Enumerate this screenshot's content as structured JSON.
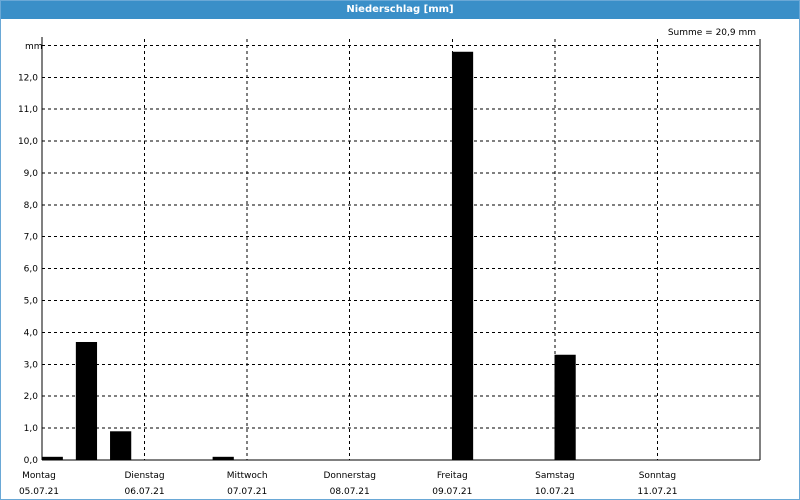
{
  "window": {
    "title": "Niederschlag [mm]"
  },
  "chart_data": {
    "type": "bar",
    "title": "Niederschlag [mm]",
    "summary_label": "Summe = 20,9 mm",
    "ylabel": "mm",
    "ylim": [
      0,
      13.2
    ],
    "yticks": [
      {
        "value": 0.0,
        "label": "0,0"
      },
      {
        "value": 1.0,
        "label": "1,0"
      },
      {
        "value": 2.0,
        "label": "2,0"
      },
      {
        "value": 3.0,
        "label": "3,0"
      },
      {
        "value": 4.0,
        "label": "4,0"
      },
      {
        "value": 5.0,
        "label": "5,0"
      },
      {
        "value": 6.0,
        "label": "6,0"
      },
      {
        "value": 7.0,
        "label": "7,0"
      },
      {
        "value": 8.0,
        "label": "8,0"
      },
      {
        "value": 9.0,
        "label": "9,0"
      },
      {
        "value": 10.0,
        "label": "10,0"
      },
      {
        "value": 11.0,
        "label": "11,0"
      },
      {
        "value": 12.0,
        "label": "12,0"
      }
    ],
    "days": [
      {
        "weekday": "Montag",
        "date": "05.07.21"
      },
      {
        "weekday": "Dienstag",
        "date": "06.07.21"
      },
      {
        "weekday": "Mittwoch",
        "date": "07.07.21"
      },
      {
        "weekday": "Donnerstag",
        "date": "08.07.21"
      },
      {
        "weekday": "Freitag",
        "date": "09.07.21"
      },
      {
        "weekday": "Samstag",
        "date": "10.07.21"
      },
      {
        "weekday": "Sonntag",
        "date": "11.07.21"
      }
    ],
    "bar_interval_hours": 8,
    "bars": [
      {
        "day": "05.07.21",
        "slot": 0,
        "value": 0.1
      },
      {
        "day": "05.07.21",
        "slot": 1,
        "value": 3.7
      },
      {
        "day": "05.07.21",
        "slot": 2,
        "value": 0.9
      },
      {
        "day": "06.07.21",
        "slot": 2,
        "value": 0.1
      },
      {
        "day": "09.07.21",
        "slot": 0,
        "value": 12.8
      },
      {
        "day": "10.07.21",
        "slot": 0,
        "value": 3.3
      }
    ],
    "grid": true,
    "colors": {
      "bar": "#000000",
      "grid": "#000000",
      "titlebar": "#3a8fc8"
    }
  }
}
